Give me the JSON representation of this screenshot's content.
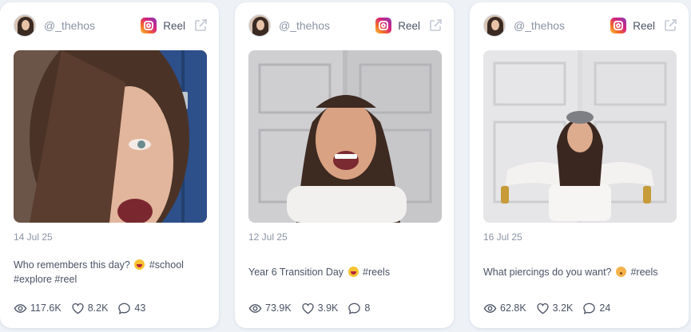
{
  "posts": [
    {
      "handle": "@_thehos",
      "type": "Reel",
      "date": "14 Jul 25",
      "caption_text": "Who remembers this day?",
      "caption_emoji": "laughing-emoji",
      "caption_tags": "#school #explore #reel",
      "views": "117.6K",
      "likes": "8.2K",
      "comments": "43"
    },
    {
      "handle": "@_thehos",
      "type": "Reel",
      "date": "12 Jul 25",
      "caption_text": "Year 6 Transition Day",
      "caption_emoji": "laughing-emoji",
      "caption_tags": "#reels",
      "views": "73.9K",
      "likes": "3.9K",
      "comments": "8"
    },
    {
      "handle": "@_thehos",
      "type": "Reel",
      "date": "16 Jul 25",
      "caption_text": "What piercings do you want?",
      "caption_emoji": "face-emoji",
      "caption_tags": "#reels",
      "views": "62.8K",
      "likes": "3.2K",
      "comments": "24"
    }
  ],
  "colors": {
    "background": "#eef2f7",
    "card": "#ffffff",
    "text_muted": "#8a93a3",
    "text_body": "#4a5263"
  },
  "icons": {
    "platform": "instagram-icon",
    "external": "external-link-icon",
    "views": "eye-icon",
    "likes": "heart-icon",
    "comments": "comment-icon"
  }
}
